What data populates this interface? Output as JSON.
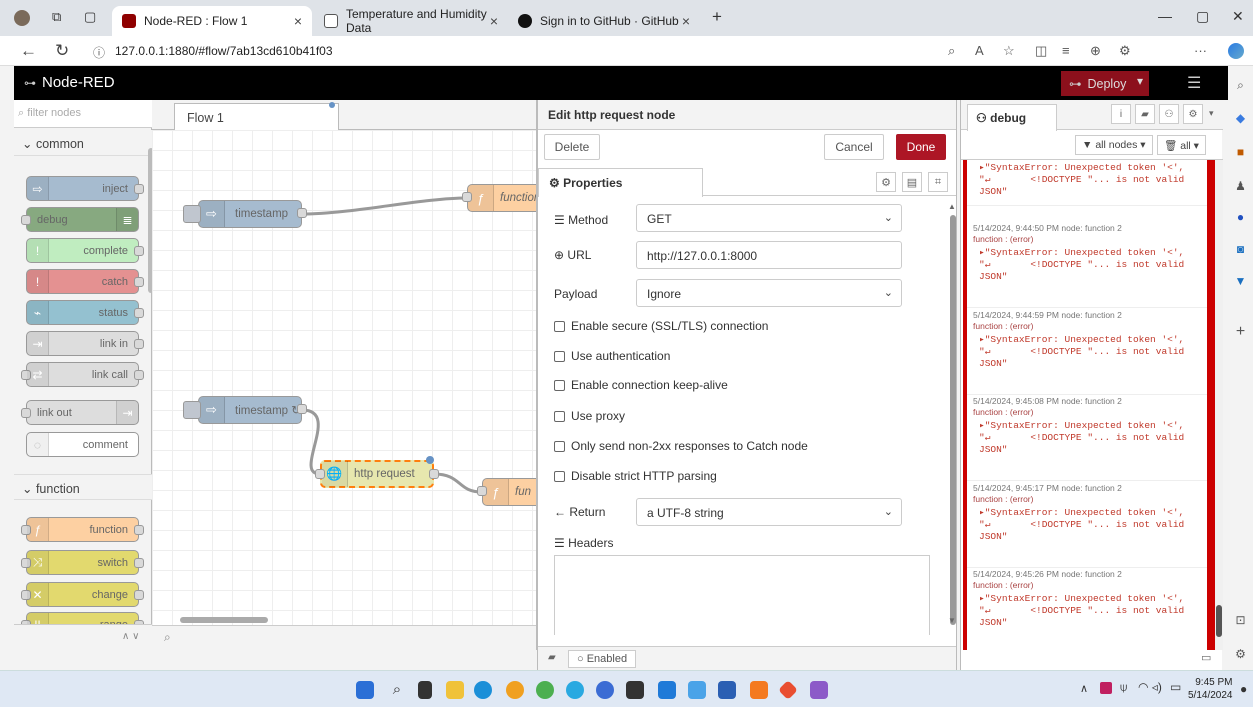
{
  "browser": {
    "tabs": [
      {
        "title": "Node-RED : Flow 1",
        "active": true
      },
      {
        "title": "Temperature and Humidity Data",
        "active": false
      },
      {
        "title": "Sign in to GitHub · GitHub",
        "active": false
      }
    ],
    "new_tab": "+",
    "url": "127.0.0.1:1880/#flow/7ab13cd610b41f03"
  },
  "nodered": {
    "title": "Node-RED",
    "deploy_label": "Deploy",
    "palette": {
      "filter_placeholder": "filter nodes",
      "categories": [
        "common",
        "function"
      ],
      "common": [
        "inject",
        "debug",
        "complete",
        "catch",
        "status",
        "link in",
        "link call",
        "link out",
        "comment"
      ],
      "function": [
        "function",
        "switch",
        "change",
        "range"
      ]
    },
    "workspace": {
      "tab": "Flow 1",
      "nodes": {
        "ts1": "timestamp",
        "fn1": "function",
        "ts2": "timestamp ↻",
        "http": "http request",
        "fn2": "fun"
      }
    },
    "tray": {
      "title": "Edit http request node",
      "delete": "Delete",
      "cancel": "Cancel",
      "done": "Done",
      "properties_tab": "Properties",
      "method_label": "Method",
      "method_value": "GET",
      "url_label": "URL",
      "url_value": "http://127.0.0.1:8000",
      "payload_label": "Payload",
      "payload_value": "Ignore",
      "checkboxes": [
        "Enable secure (SSL/TLS) connection",
        "Use authentication",
        "Enable connection keep-alive",
        "Use proxy",
        "Only send non-2xx responses to Catch node",
        "Disable strict HTTP parsing"
      ],
      "return_label": "Return",
      "return_value": "a UTF-8 string",
      "headers_label": "Headers",
      "enabled": "Enabled"
    },
    "debug": {
      "tab": "debug",
      "filter_nodes": "all nodes",
      "filter_all": "all",
      "messages": [
        {
          "meta": "",
          "topic": "",
          "body": "▸\"SyntaxError: Unexpected token '<',\n\"↵       <!DOCTYPE \"... is not valid\nJSON\""
        },
        {
          "meta": "5/14/2024, 9:44:50 PM  node: function 2",
          "topic": "function : (error)",
          "body": "▸\"SyntaxError: Unexpected token '<',\n\"↵       <!DOCTYPE \"... is not valid\nJSON\""
        },
        {
          "meta": "5/14/2024, 9:44:59 PM  node: function 2",
          "topic": "function : (error)",
          "body": "▸\"SyntaxError: Unexpected token '<',\n\"↵       <!DOCTYPE \"... is not valid\nJSON\""
        },
        {
          "meta": "5/14/2024, 9:45:08 PM  node: function 2",
          "topic": "function : (error)",
          "body": "▸\"SyntaxError: Unexpected token '<',\n\"↵       <!DOCTYPE \"... is not valid\nJSON\""
        },
        {
          "meta": "5/14/2024, 9:45:17 PM  node: function 2",
          "topic": "function : (error)",
          "body": "▸\"SyntaxError: Unexpected token '<',\n\"↵       <!DOCTYPE \"... is not valid\nJSON\""
        },
        {
          "meta": "5/14/2024, 9:45:26 PM  node: function 2",
          "topic": "function : (error)",
          "body": "▸\"SyntaxError: Unexpected token '<',\n\"↵       <!DOCTYPE \"... is not valid\nJSON\""
        }
      ]
    }
  },
  "taskbar": {
    "time": "9:45 PM",
    "date": "5/14/2024"
  },
  "colors": {
    "deploy": "#8c101c",
    "done": "#ad1625",
    "inject": "#a6bbcf",
    "debug": "#87a980",
    "complete": "#c0edc0",
    "catch": "#e49191",
    "status": "#94c1d0",
    "link": "#dddddd",
    "function": "#fdd0a2",
    "switch": "#e2d96e",
    "change": "#e2d96e",
    "range": "#e2d96e",
    "http": "#e7e7ae"
  }
}
